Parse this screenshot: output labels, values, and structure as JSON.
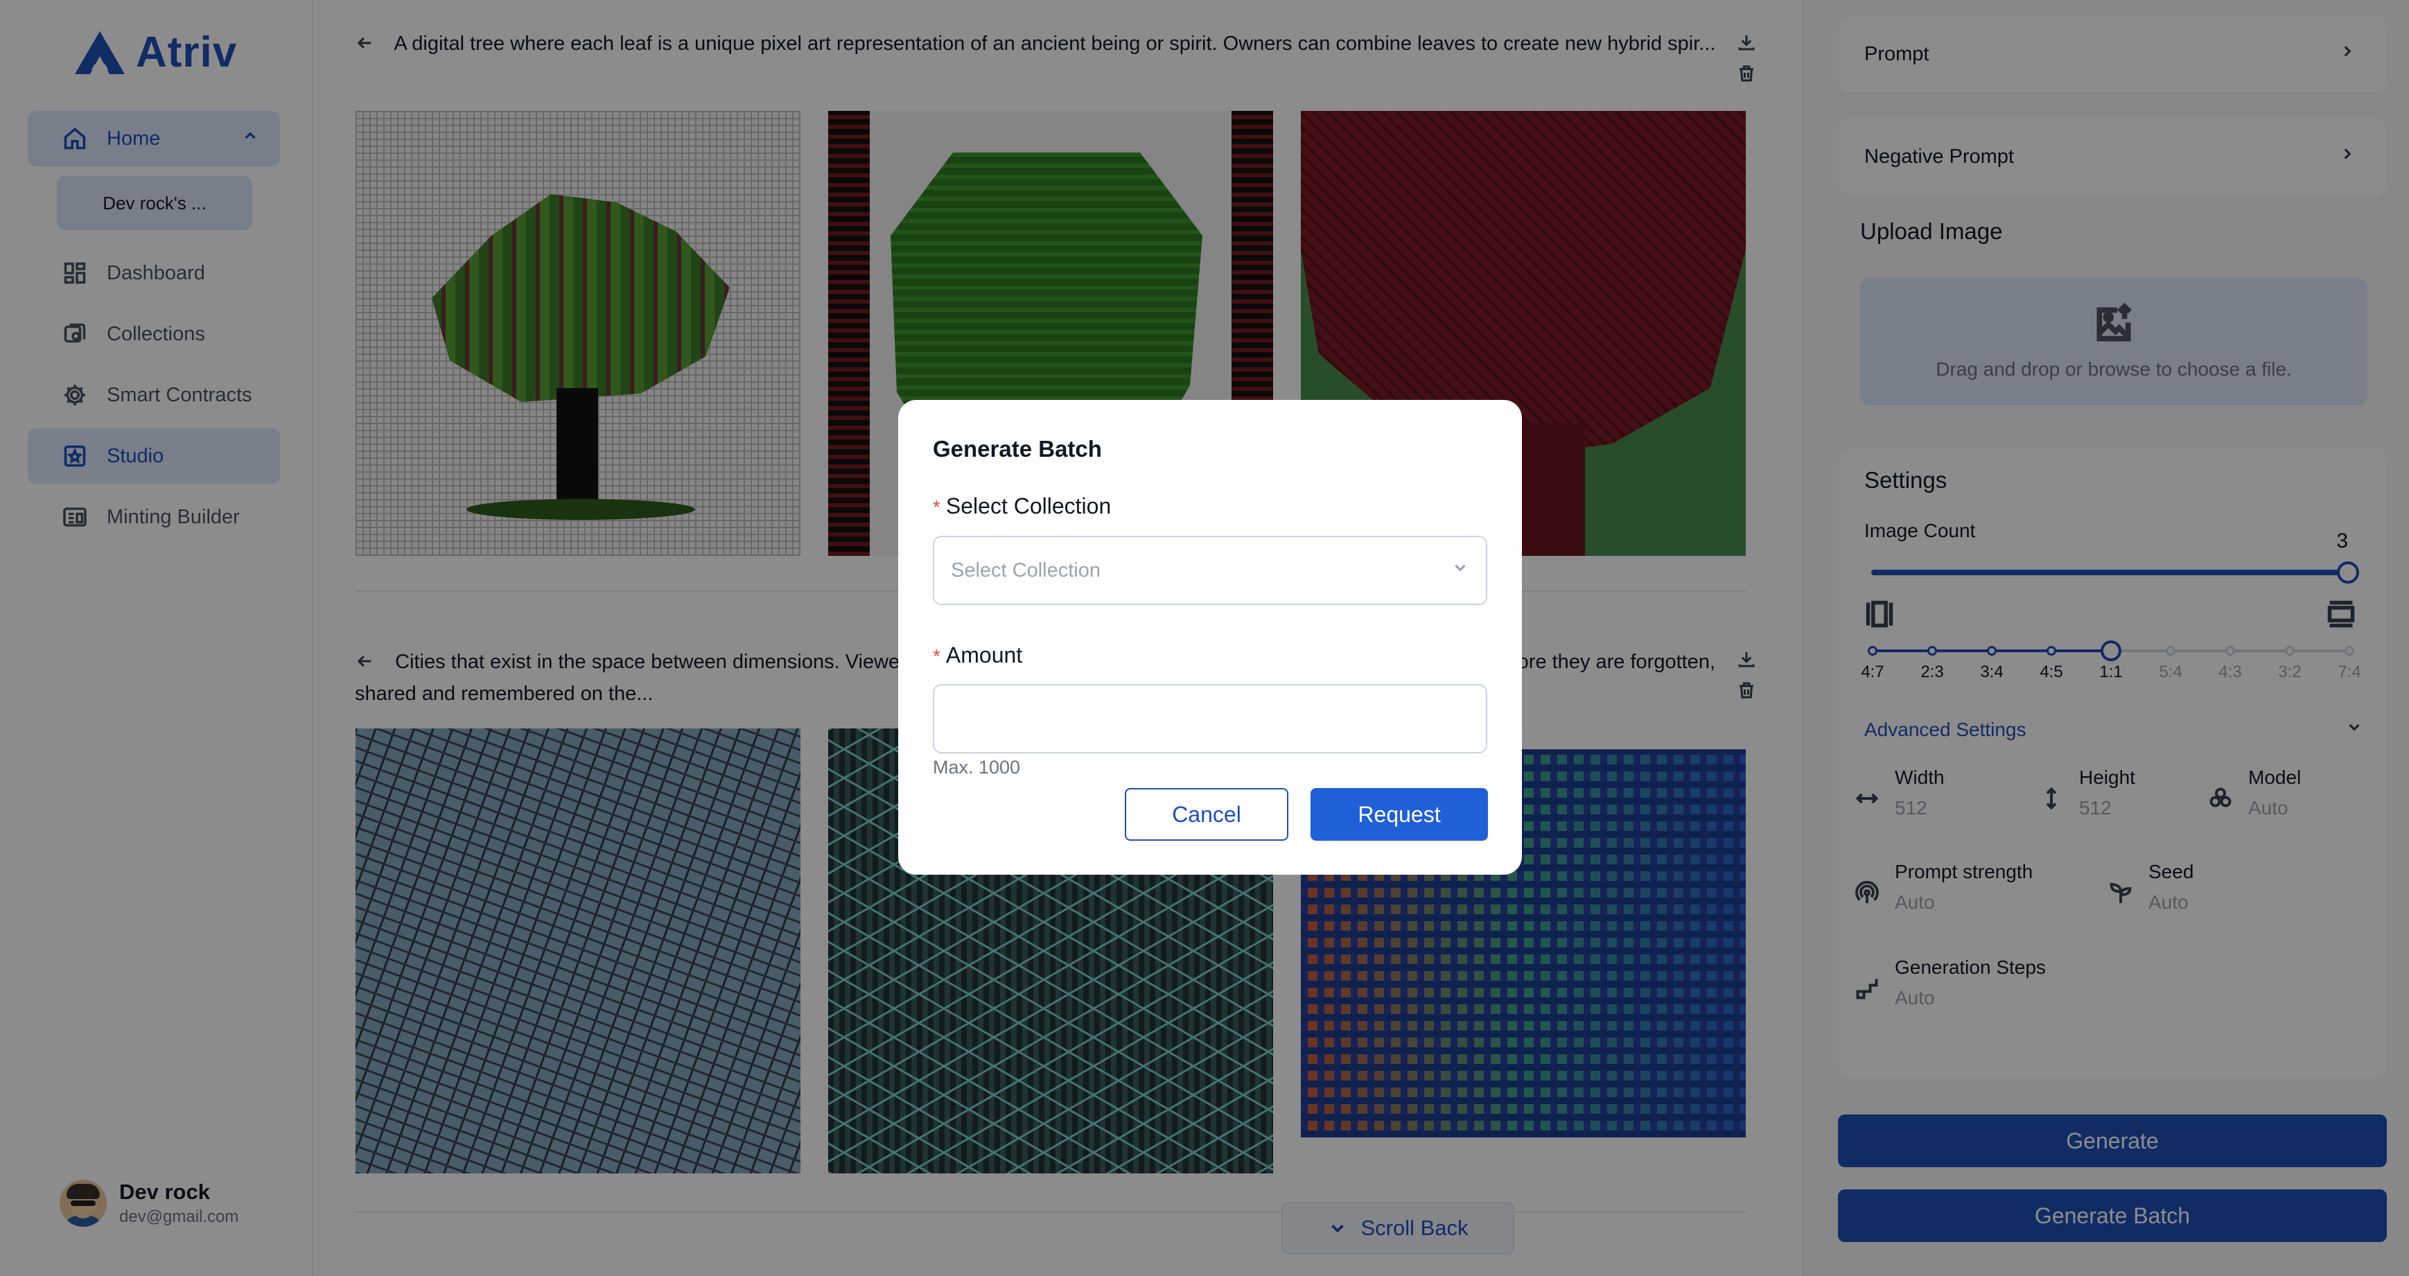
{
  "brand": {
    "name": "Atriv",
    "color": "#1f4fb8"
  },
  "sidebar": {
    "items": [
      {
        "label": "Home",
        "icon": "home-icon",
        "active": true
      },
      {
        "label": "Dashboard",
        "icon": "dashboard-icon"
      },
      {
        "label": "Collections",
        "icon": "collections-icon"
      },
      {
        "label": "Smart Contracts",
        "icon": "gear-icon"
      },
      {
        "label": "Studio",
        "icon": "studio-icon",
        "active": true
      },
      {
        "label": "Minting Builder",
        "icon": "minting-icon"
      }
    ],
    "home_sub_item": "Dev rock's ..."
  },
  "user": {
    "name": "Dev rock",
    "email": "dev@gmail.com"
  },
  "gallery": {
    "cards": [
      {
        "prompt": "A digital tree where each leaf is a unique pixel art representation of an ancient being or spirit. Owners can combine leaves to create new hybrid spir..."
      },
      {
        "prompt": "Cities that exist in the space between dimensions. Viewers can explore these cities, each one unique and only visible once before they are forgotten, shared and remembered on the..."
      }
    ],
    "scroll_back_label": "Scroll Back"
  },
  "panel": {
    "prompt_label": "Prompt",
    "negative_prompt_label": "Negative Prompt",
    "upload_title": "Upload Image",
    "upload_hint": "Drag and drop or browse to choose a file.",
    "settings_title": "Settings",
    "image_count_label": "Image Count",
    "image_count_value": "3",
    "image_count_fraction": 1.0,
    "aspect_ratios": [
      "4:7",
      "2:3",
      "3:4",
      "4:5",
      "1:1",
      "5:4",
      "4:3",
      "3:2",
      "7:4"
    ],
    "aspect_ratio_selected": "1:1",
    "advanced_label": "Advanced Settings",
    "params": {
      "width": {
        "label": "Width",
        "value": "512"
      },
      "height": {
        "label": "Height",
        "value": "512"
      },
      "model": {
        "label": "Model",
        "value": "Auto"
      },
      "prompt_strength": {
        "label": "Prompt strength",
        "value": "Auto"
      },
      "seed": {
        "label": "Seed",
        "value": "Auto"
      },
      "steps": {
        "label": "Generation Steps",
        "value": "Auto"
      }
    },
    "generate_label": "Generate",
    "generate_batch_label": "Generate Batch"
  },
  "modal": {
    "title": "Generate Batch",
    "collection_label": "Select Collection",
    "collection_placeholder": "Select Collection",
    "amount_label": "Amount",
    "amount_value": "",
    "amount_hint": "Max. 1000",
    "cancel_label": "Cancel",
    "request_label": "Request"
  }
}
